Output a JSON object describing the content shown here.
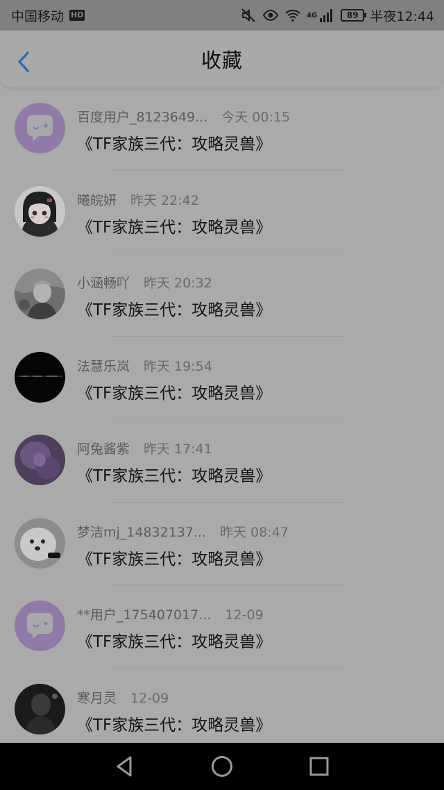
{
  "status_bar": {
    "carrier": "中国移动",
    "hd": "HD",
    "network": "4G",
    "battery": "89",
    "time": "半夜12:44"
  },
  "header": {
    "title": "收藏",
    "back_icon": "chevron-left-icon"
  },
  "colors": {
    "back_icon": "#2a6fb0",
    "bubble_avatar_bg": "#8f7aa8"
  },
  "favorites": [
    {
      "user": "百度用户_8123649...",
      "time": "今天 00:15",
      "text": "《TF家族三代：攻略灵兽》",
      "avatar": "bubble"
    },
    {
      "user": "曦皖妍",
      "time": "昨天 22:42",
      "text": "《TF家族三代：攻略灵兽》",
      "avatar": "anime-girl"
    },
    {
      "user": "小涵畅吖",
      "time": "昨天 20:32",
      "text": "《TF家族三代：攻略灵兽》",
      "avatar": "photo-gray"
    },
    {
      "user": "法慧乐岚",
      "time": "昨天 19:54",
      "text": "《TF家族三代：攻略灵兽》",
      "avatar": "black-text"
    },
    {
      "user": "阿兔酱紫",
      "time": "昨天 17:41",
      "text": "《TF家族三代：攻略灵兽》",
      "avatar": "purple-photo"
    },
    {
      "user": "梦洁mj_14832137...",
      "time": "昨天 08:47",
      "text": "《TF家族三代：攻略灵兽》",
      "avatar": "dog"
    },
    {
      "user": "**用户_175407017...",
      "time": "12-09",
      "text": "《TF家族三代：攻略灵兽》",
      "avatar": "bubble"
    },
    {
      "user": "寒月灵",
      "time": "12-09",
      "text": "《TF家族三代：攻略灵兽》",
      "avatar": "dark-photo"
    }
  ],
  "nav_bar": {
    "back": "triangle-back-icon",
    "home": "circle-home-icon",
    "recents": "square-recents-icon"
  }
}
